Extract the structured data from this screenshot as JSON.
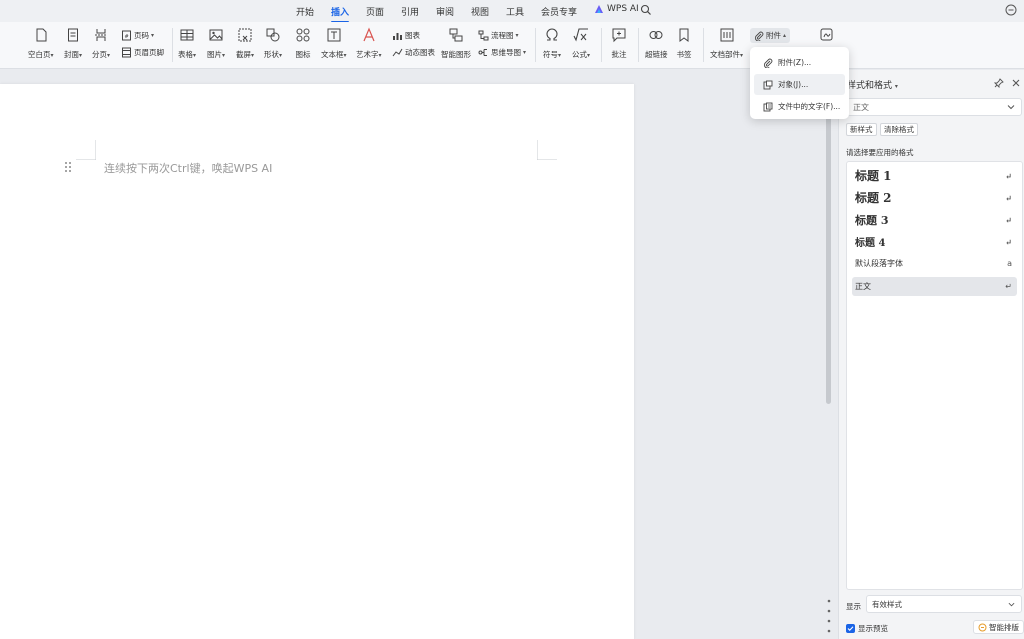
{
  "tabs": [
    {
      "label": "开始",
      "active": false
    },
    {
      "label": "插入",
      "active": true
    },
    {
      "label": "页面",
      "active": false
    },
    {
      "label": "引用",
      "active": false
    },
    {
      "label": "审阅",
      "active": false
    },
    {
      "label": "视图",
      "active": false
    },
    {
      "label": "工具",
      "active": false
    },
    {
      "label": "会员专享",
      "active": false
    }
  ],
  "ai_tab": {
    "label": "WPS AI",
    "icon": "wps-ai-logo-icon"
  },
  "ribbon": {
    "blank_page": "空白页",
    "cover": "封面",
    "page_break": "分页",
    "page_number": "页码",
    "header_footer": "页眉页脚",
    "table": "表格",
    "picture": "图片",
    "screenshot": "截屏",
    "shape": "形状",
    "icon": "图标",
    "textbox": "文本框",
    "wordart": "艺术字",
    "chart": "图表",
    "dynamic_chart": "动态图表",
    "smart_graphic": "智能图形",
    "flowchart": "流程图",
    "mindmap": "思维导图",
    "symbol": "符号",
    "formula": "公式",
    "comment": "批注",
    "hyperlink": "超链接",
    "bookmark": "书签",
    "doc_parts": "文档部件",
    "attachment": "附件"
  },
  "dropdown": {
    "items": [
      {
        "label": "附件(Z)...",
        "icon": "paperclip-icon"
      },
      {
        "label": "对象(J)...",
        "icon": "object-icon"
      },
      {
        "label": "文件中的文字(F)...",
        "icon": "file-text-icon"
      }
    ]
  },
  "document": {
    "hint": "连续按下两次Ctrl键，唤起WPS AI"
  },
  "pane": {
    "title": "样式和格式",
    "current_style": "正文",
    "new_style": "新样式",
    "clear_format": "清除格式",
    "choose_label": "请选择要应用的格式",
    "styles": [
      {
        "label": "标题  1",
        "mark": "↵"
      },
      {
        "label": "标题  2",
        "mark": "↵"
      },
      {
        "label": "标题  3",
        "mark": "↵"
      },
      {
        "label": "标题  4",
        "mark": "↵"
      },
      {
        "label": "默认段落字体",
        "mark": "a"
      },
      {
        "label": "正文",
        "mark": "↵"
      }
    ],
    "show_label": "显示",
    "show_value": "有效样式",
    "preview_label": "显示预览",
    "preview_checked": true,
    "smart_layout": "智能排版"
  },
  "colors": {
    "accent": "#1a64e6"
  }
}
